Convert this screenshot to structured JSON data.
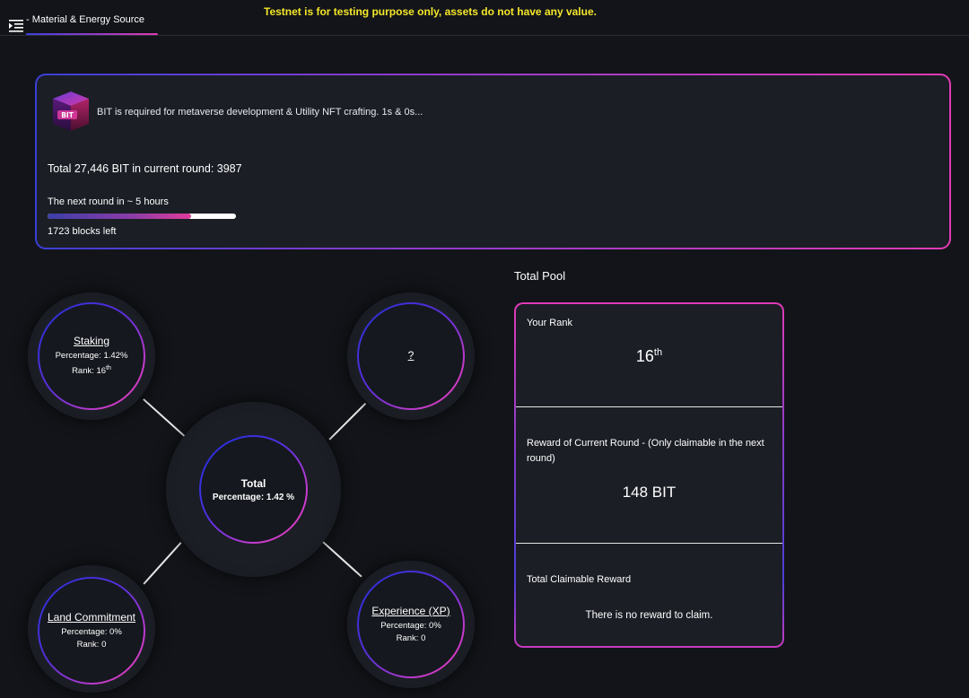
{
  "header": {
    "breadcrumb": "- Material & Energy Source",
    "banner": "Testnet is for testing purpose only, assets do not have any value.",
    "banner_color": "#f5e629",
    "menu_icon": "menu-indent-icon"
  },
  "info": {
    "logo_text": "BIT",
    "description": "BIT is required for metaverse development & Utility NFT crafting. 1s & 0s...",
    "total": "Total 27,446 BIT in current round: 3987",
    "next_round": "The next round in ~ 5 hours",
    "progress": 0.76,
    "blocks_left": "1723 blocks left"
  },
  "circles": {
    "staking": {
      "title": "Staking",
      "percentage": "Percentage: 1.42%",
      "rank_prefix": "Rank: 16",
      "rank_suffix": "th"
    },
    "unknown": {
      "title": "?"
    },
    "center": {
      "title": "Total",
      "percentage": "Percentage: 1.42 %"
    },
    "land": {
      "title": "Land Commitment",
      "percentage": "Percentage: 0%",
      "rank": "Rank: 0"
    },
    "xp": {
      "title": "Experience (XP)",
      "percentage": "Percentage: 0%",
      "rank": "Rank: 0"
    }
  },
  "pool": {
    "heading": "Total Pool",
    "rank_label": "Your Rank",
    "rank_value": "16",
    "rank_suffix": "th",
    "reward_label": "Reward of Current Round - (Only claimable in the next round)",
    "reward_value": "148 BIT",
    "claimable_label": "Total Claimable Reward",
    "claimable_value": "There is no reward to claim."
  },
  "colors": {
    "background": "#121419",
    "card": "#1b1e25",
    "accent_blue": "#3c3fe0",
    "accent_pink": "#e23bb3"
  }
}
